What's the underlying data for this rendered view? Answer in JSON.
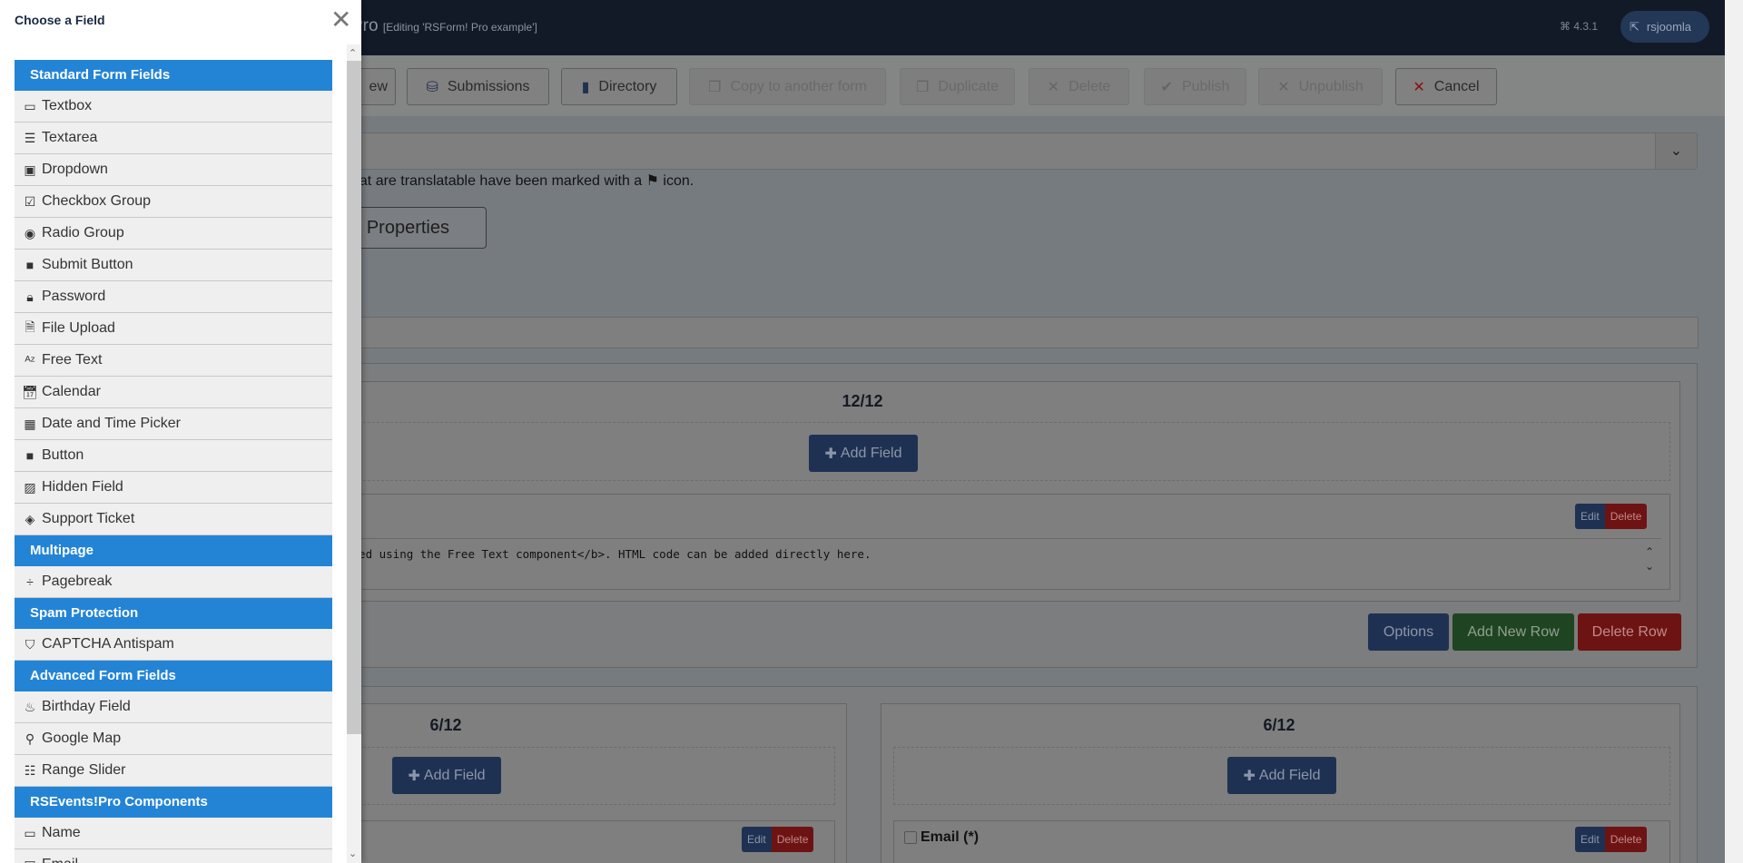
{
  "navbar": {
    "title": "Pro",
    "subtitle": "[Editing 'RSForm! Pro example']",
    "version": "4.3.1",
    "user": "rsjoomla"
  },
  "toolbar": {
    "buttons": [
      {
        "label": "ew",
        "icon": "preview-icon",
        "enabled": true
      },
      {
        "label": "Submissions",
        "icon": "database-icon",
        "enabled": true
      },
      {
        "label": "Directory",
        "icon": "folder-icon",
        "enabled": true
      },
      {
        "label": "Copy to another form",
        "icon": "copy-icon",
        "enabled": false
      },
      {
        "label": "Duplicate",
        "icon": "copy-icon",
        "enabled": false
      },
      {
        "label": "Delete",
        "icon": "x-icon",
        "enabled": false
      },
      {
        "label": "Publish",
        "icon": "check-icon",
        "enabled": false
      },
      {
        "label": "Unpublish",
        "icon": "x-icon",
        "enabled": false
      },
      {
        "label": "Cancel",
        "icon": "x-icon",
        "enabled": true
      }
    ]
  },
  "main": {
    "translation_note": "hat are translatable have been marked with a ⚑ icon.",
    "properties_label": "Properties",
    "row1": {
      "col_label": "12/12",
      "add_field": "Add Field",
      "edit": "Edit",
      "delete": "Delete",
      "code": "dded using the Free Text component</b>. HTML code can be added directly here.",
      "options": "Options",
      "add_row": "Add New Row",
      "delete_row": "Delete Row"
    },
    "row2": {
      "left_label": "6/12",
      "right_label": "6/12",
      "add_field": "Add Field",
      "edit": "Edit",
      "delete": "Delete",
      "email_label": "Email (*)"
    }
  },
  "sidebar": {
    "title": "Choose a Field",
    "sections": [
      {
        "title": "Standard Form Fields",
        "items": [
          {
            "label": "Textbox",
            "icon": "textbox-icon"
          },
          {
            "label": "Textarea",
            "icon": "textarea-icon"
          },
          {
            "label": "Dropdown",
            "icon": "dropdown-icon"
          },
          {
            "label": "Checkbox Group",
            "icon": "checkbox-icon"
          },
          {
            "label": "Radio Group",
            "icon": "radio-icon"
          },
          {
            "label": "Submit Button",
            "icon": "button-icon"
          },
          {
            "label": "Password",
            "icon": "lock-icon"
          },
          {
            "label": "File Upload",
            "icon": "file-icon"
          },
          {
            "label": "Free Text",
            "icon": "a-z-icon"
          },
          {
            "label": "Calendar",
            "icon": "calendar-icon"
          },
          {
            "label": "Date and Time Picker",
            "icon": "calendar-grid-icon"
          },
          {
            "label": "Button",
            "icon": "button-icon"
          },
          {
            "label": "Hidden Field",
            "icon": "hidden-icon"
          },
          {
            "label": "Support Ticket",
            "icon": "ticket-icon"
          }
        ]
      },
      {
        "title": "Multipage",
        "items": [
          {
            "label": "Pagebreak",
            "icon": "pagebreak-icon"
          }
        ]
      },
      {
        "title": "Spam Protection",
        "items": [
          {
            "label": "CAPTCHA Antispam",
            "icon": "shield-icon"
          }
        ]
      },
      {
        "title": "Advanced Form Fields",
        "items": [
          {
            "label": "Birthday Field",
            "icon": "birthday-cake-icon"
          },
          {
            "label": "Google Map",
            "icon": "map-marker-icon"
          },
          {
            "label": "Range Slider",
            "icon": "list-icon"
          }
        ]
      },
      {
        "title": "RSEvents!Pro Components",
        "items": [
          {
            "label": "Name",
            "icon": "textbox-icon"
          },
          {
            "label": "Email",
            "icon": "dropdown-icon"
          }
        ]
      }
    ]
  },
  "colors": {
    "section_header": "#2384d6",
    "navbar": "#121a27",
    "options": "#1f3152",
    "add_row": "#1f4422",
    "delete_row": "#6e1313"
  }
}
